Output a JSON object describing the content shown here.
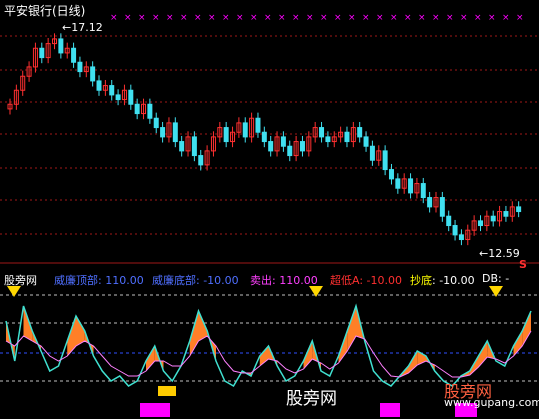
{
  "title": "平安银行(日线)",
  "price_high_label": "17.12",
  "price_low_label": "12.59",
  "s_marker": "S",
  "indicator": {
    "name": "股旁网",
    "items": [
      {
        "label": "威廉顶部",
        "value": "110.00",
        "color": "#4f6fff",
        "valcolor": "#4f6fff"
      },
      {
        "label": "威廉底部",
        "value": "-10.00",
        "color": "#4f6fff",
        "valcolor": "#4f6fff"
      },
      {
        "label": "卖出",
        "value": "110.00",
        "color": "#ff40ff",
        "valcolor": "#ff40ff"
      },
      {
        "label": "超低A",
        "value": "-10.00",
        "color": "#ff3030",
        "valcolor": "#ff3030"
      },
      {
        "label": "抄底",
        "value": "-10.00",
        "color": "#ffff00",
        "valcolor": "#ffffff"
      },
      {
        "label": "DB",
        "value": "-",
        "color": "#ffffff",
        "valcolor": "#ffffff"
      }
    ]
  },
  "watermark": {
    "left": "股旁网",
    "right_brand": "股旁网",
    "right_url": "www.gupang.com"
  },
  "colors": {
    "up": "#ff3030",
    "down": "#40e0f0",
    "grid": "#a01818",
    "buy": "#ff00ff"
  },
  "chart_data": {
    "type": "candlestick",
    "price_max": 17.12,
    "price_min": 12.59,
    "closes": [
      15.6,
      15.9,
      16.2,
      16.4,
      16.8,
      16.6,
      16.9,
      17.0,
      16.7,
      16.8,
      16.5,
      16.3,
      16.4,
      16.1,
      15.9,
      16.0,
      15.8,
      15.7,
      15.9,
      15.6,
      15.4,
      15.6,
      15.3,
      15.1,
      14.9,
      15.2,
      14.8,
      14.6,
      14.9,
      14.5,
      14.3,
      14.6,
      14.9,
      15.1,
      14.8,
      15.0,
      15.2,
      14.9,
      15.3,
      15.0,
      14.8,
      14.6,
      14.9,
      14.7,
      14.5,
      14.8,
      14.6,
      14.9,
      15.1,
      14.9,
      14.8,
      14.9,
      15.0,
      14.8,
      15.1,
      14.9,
      14.7,
      14.4,
      14.6,
      14.2,
      14.0,
      13.8,
      14.0,
      13.7,
      13.9,
      13.6,
      13.4,
      13.6,
      13.2,
      13.0,
      12.8,
      12.7,
      12.9,
      13.1,
      13.0,
      13.2,
      13.1,
      13.3,
      13.2,
      13.4,
      13.3
    ],
    "indicator_series": {
      "fast": [
        80,
        40,
        95,
        70,
        50,
        30,
        35,
        60,
        85,
        70,
        45,
        30,
        20,
        25,
        15,
        20,
        40,
        55,
        30,
        20,
        35,
        60,
        90,
        70,
        40,
        20,
        15,
        30,
        25,
        45,
        55,
        35,
        20,
        25,
        40,
        60,
        30,
        25,
        45,
        70,
        95,
        60,
        30,
        20,
        15,
        25,
        35,
        50,
        45,
        30,
        20,
        15,
        25,
        30,
        45,
        60,
        40,
        35,
        55,
        70,
        90
      ],
      "slow": [
        60,
        55,
        65,
        60,
        55,
        45,
        40,
        45,
        55,
        60,
        55,
        45,
        35,
        30,
        25,
        25,
        30,
        40,
        40,
        35,
        35,
        45,
        60,
        65,
        55,
        40,
        30,
        28,
        28,
        35,
        42,
        40,
        32,
        28,
        32,
        42,
        38,
        32,
        38,
        50,
        65,
        62,
        48,
        35,
        25,
        24,
        28,
        36,
        40,
        36,
        30,
        24,
        24,
        26,
        34,
        44,
        42,
        38,
        45,
        55,
        70
      ]
    }
  }
}
